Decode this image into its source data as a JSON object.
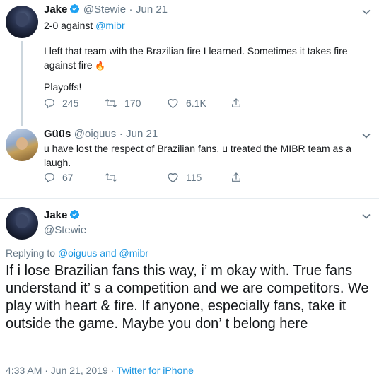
{
  "tweet1": {
    "name": "Jake",
    "handle": "@Stewie",
    "dot": "·",
    "date": "Jun 21",
    "line1_prefix": "2-0 against ",
    "line1_mention": "@mibr",
    "para1": "I left that team with the Brazilian fire I learned. Sometimes it takes fire against fire",
    "emoji": "🔥",
    "para2": "Playoffs!",
    "replies": "245",
    "retweets": "170",
    "likes": "6.1K"
  },
  "tweet2": {
    "name": "Güüs",
    "handle": "@oiguus",
    "dot": "·",
    "date": "Jun 21",
    "text": "u have lost the respect of Brazilian fans, u treated the MIBR team as a laugh.",
    "replies": "67",
    "retweets": "",
    "likes": "115"
  },
  "main": {
    "name": "Jake",
    "handle": "@Stewie",
    "replying_prefix": "Replying to ",
    "replying_user1": "@oiguus",
    "replying_and": " and ",
    "replying_user2": "@mibr",
    "text": "If i lose Brazilian fans this way, i’ m okay with. True fans understand it’ s a competition and we are competitors. We play with heart & fire. If anyone, especially fans, take it outside the game. Maybe you don’ t belong here",
    "timestamp": "4:33 AM · Jun 21, 2019 · ",
    "source": "Twitter for iPhone"
  },
  "colors": {
    "accent": "#1b95e0",
    "secondary_text": "#657786",
    "primary_text": "#14171a",
    "thread_line": "#ccd6dd"
  },
  "icons": [
    "verified-icon",
    "caret-down-icon",
    "reply-icon",
    "retweet-icon",
    "like-icon",
    "share-icon"
  ]
}
